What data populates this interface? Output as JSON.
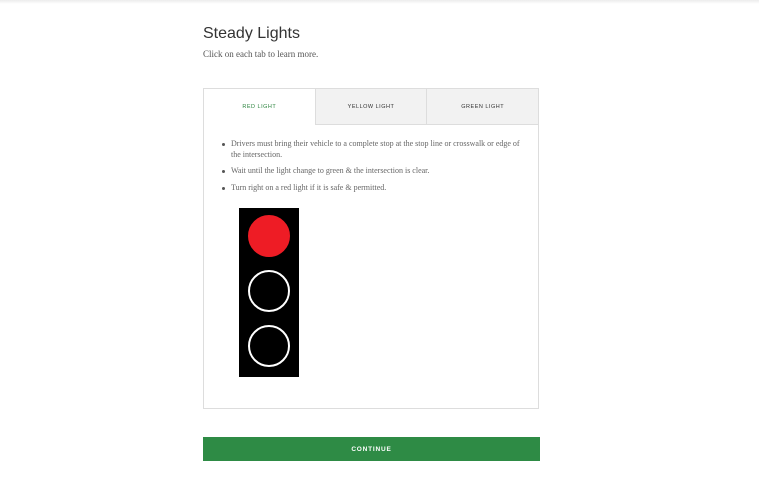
{
  "page": {
    "title": "Steady Lights",
    "subtitle": "Click on each tab to learn more."
  },
  "tabs": [
    {
      "label": "RED LIGHT",
      "active": true
    },
    {
      "label": "YELLOW LIGHT",
      "active": false
    },
    {
      "label": "GREEN LIGHT",
      "active": false
    }
  ],
  "content": {
    "bullets": [
      "Drivers must bring their vehicle to a complete stop at the stop line or crosswalk or edge of the intersection.",
      "Wait until the light change to green & the intersection is clear.",
      "Turn right on a red light if it is safe & permitted."
    ],
    "traffic_light": {
      "lit_lamp": "red",
      "colors": {
        "red": "#ee1c25",
        "housing": "#000000",
        "unlit_ring": "#ffffff"
      }
    }
  },
  "footer": {
    "continue_label": "CONTINUE"
  },
  "colors": {
    "accent": "#2e8b45",
    "active_tab_text": "#2e8540"
  }
}
